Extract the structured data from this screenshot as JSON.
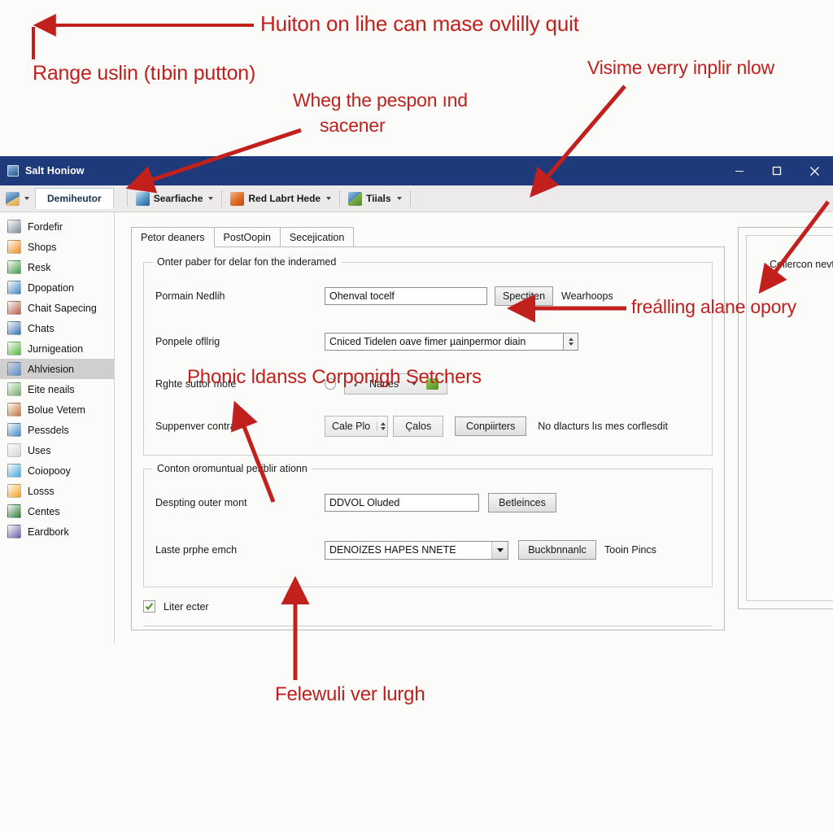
{
  "annotations": {
    "accent_color": "#c2201d",
    "items": [
      {
        "id": "range-button-note",
        "text": "Range uslin (tıbin putton)"
      },
      {
        "id": "top-arrow-note",
        "text": "Huiton on lihe can mase ovlilly quit"
      },
      {
        "id": "pespon-note-line1",
        "text": "Wheg the pespon ınd"
      },
      {
        "id": "pespon-note-line2",
        "text": "sacener"
      },
      {
        "id": "visime-note",
        "text": "Visime verry inplir nlow"
      },
      {
        "id": "frealling-note",
        "text": "freálling alane opory"
      },
      {
        "id": "phonic-note",
        "text": "Phonic ldanss Corponigh Setchers"
      },
      {
        "id": "felewuli-note",
        "text": "Felewuli ver lurgh"
      }
    ]
  },
  "window": {
    "title": "Salt Honiow",
    "controls": {
      "minimize": "minimize-icon",
      "maximize": "maximize-icon",
      "close": "close-icon"
    }
  },
  "toolbar": {
    "app_tab": "Demiheutor",
    "buttons": [
      {
        "label": "Searfiache",
        "icon": "search-doc-icon"
      },
      {
        "label": "Red Labrt Hede",
        "icon": "red-chart-icon"
      },
      {
        "label": "Tiials",
        "icon": "people-icon"
      }
    ]
  },
  "sidebar": {
    "items": [
      {
        "label": "Fordefir",
        "icon": "server-icon",
        "color": "#7a8a99",
        "selected": false
      },
      {
        "label": "Shops",
        "icon": "flame-icon",
        "color": "#ef8b22",
        "selected": false
      },
      {
        "label": "Resk",
        "icon": "globe-icon",
        "color": "#3f9a46",
        "selected": false
      },
      {
        "label": "Dpopation",
        "icon": "window-icon",
        "color": "#3f86c4",
        "selected": false
      },
      {
        "label": "Chait Sapecing",
        "icon": "wrench-icon",
        "color": "#b35c4a",
        "selected": false
      },
      {
        "label": "Chats",
        "icon": "chart-icon",
        "color": "#3b6fb0",
        "selected": false
      },
      {
        "label": "Jurnigeation",
        "icon": "gear-green-icon",
        "color": "#59b342",
        "selected": false
      },
      {
        "label": "Ahlviesion",
        "icon": "tools-icon",
        "color": "#5b8fc9",
        "selected": true
      },
      {
        "label": "Eite neails",
        "icon": "page-icon",
        "color": "#6fae6a",
        "selected": false
      },
      {
        "label": "Bolue Vetem",
        "icon": "book-icon",
        "color": "#c4743a",
        "selected": false
      },
      {
        "label": "Pessdels",
        "icon": "folder-icon",
        "color": "#3f86c4",
        "selected": false
      },
      {
        "label": "Uses",
        "icon": "page-blank-icon",
        "color": "#cfd6da",
        "selected": false
      },
      {
        "label": "Coiopooy",
        "icon": "disc-icon",
        "color": "#47a8d8",
        "selected": false
      },
      {
        "label": "Losss",
        "icon": "clipboard-icon",
        "color": "#efa122",
        "selected": false
      },
      {
        "label": "Centes",
        "icon": "bag-icon",
        "color": "#2f7a35",
        "selected": false
      },
      {
        "label": "Eardbork",
        "icon": "info-icon",
        "color": "#6a5aa8",
        "selected": false
      }
    ]
  },
  "tabs": [
    {
      "label": "Petor deaners",
      "active": true
    },
    {
      "label": "PostOopin",
      "active": false
    },
    {
      "label": "Secejication",
      "active": false
    }
  ],
  "group_one": {
    "title": "Onter paber for delar fon the inderamed",
    "row_name": {
      "label": "Pormain Nedlih",
      "value": "Ohenval tocelf",
      "button": "Spectiten",
      "hint": "Wearhoops"
    },
    "row_file": {
      "label": "Ponpele ofllrig",
      "value": "Cniced Tidelen oave fimer µainpermor diain"
    },
    "row_mode": {
      "label": "Rghte suttor mofe",
      "option": "Nanes"
    },
    "row_supervisor": {
      "label": "Suppenver contral",
      "spin_label": "Cale Plo",
      "seg_label": "Çalos",
      "button": "Conpiirters",
      "hint": "No dlacturs lıs mes corflesdit"
    }
  },
  "group_two": {
    "title": "Conton oromuntual periblir ationn",
    "row_path": {
      "label": "Despting outer mont",
      "value": "DDVOL Oluded",
      "button": "Betleinces"
    },
    "row_select": {
      "label": "Laste prphe emch",
      "value": "DENOIZES HAPES NNETE",
      "button": "Buckbnnanlc",
      "hint": "Tooin Pincs"
    }
  },
  "footer_check": {
    "label": "Liter ecter",
    "checked": true
  },
  "right_panel": {
    "text": "Collercon nevt"
  }
}
